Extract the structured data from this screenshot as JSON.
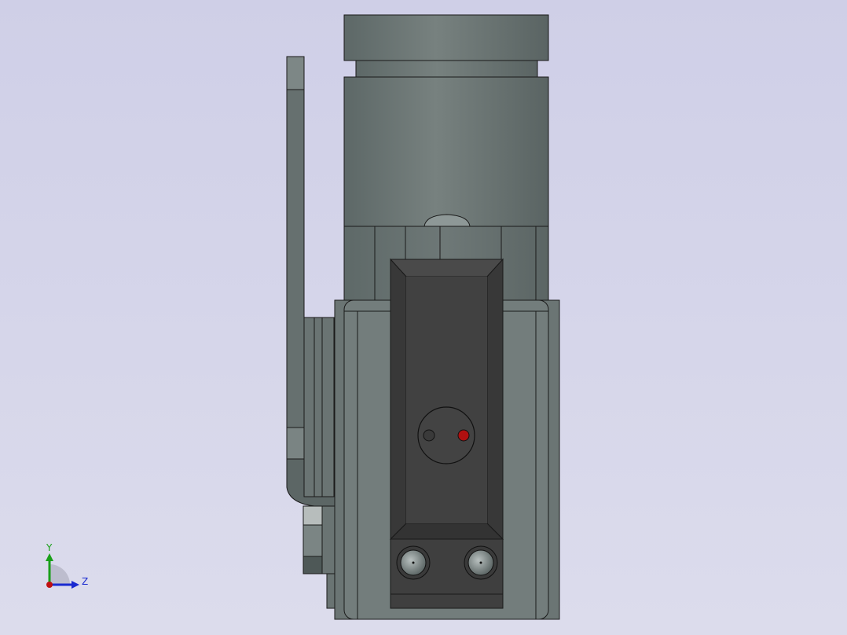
{
  "viewport": {
    "title": "",
    "background_top": "#cfcfe7",
    "background_bottom": "#dcdcec"
  },
  "model": {
    "body_color": "#6f7a79",
    "dark_plate_color": "#3f3f3f",
    "edge_color": "#1a1a1a",
    "indicator_led_color": "#b01010"
  },
  "triad": {
    "y_label": "Y",
    "z_label": "Z",
    "y_color": "#1aa01a",
    "z_color": "#1a2ad0",
    "x_color": "#c01010"
  }
}
